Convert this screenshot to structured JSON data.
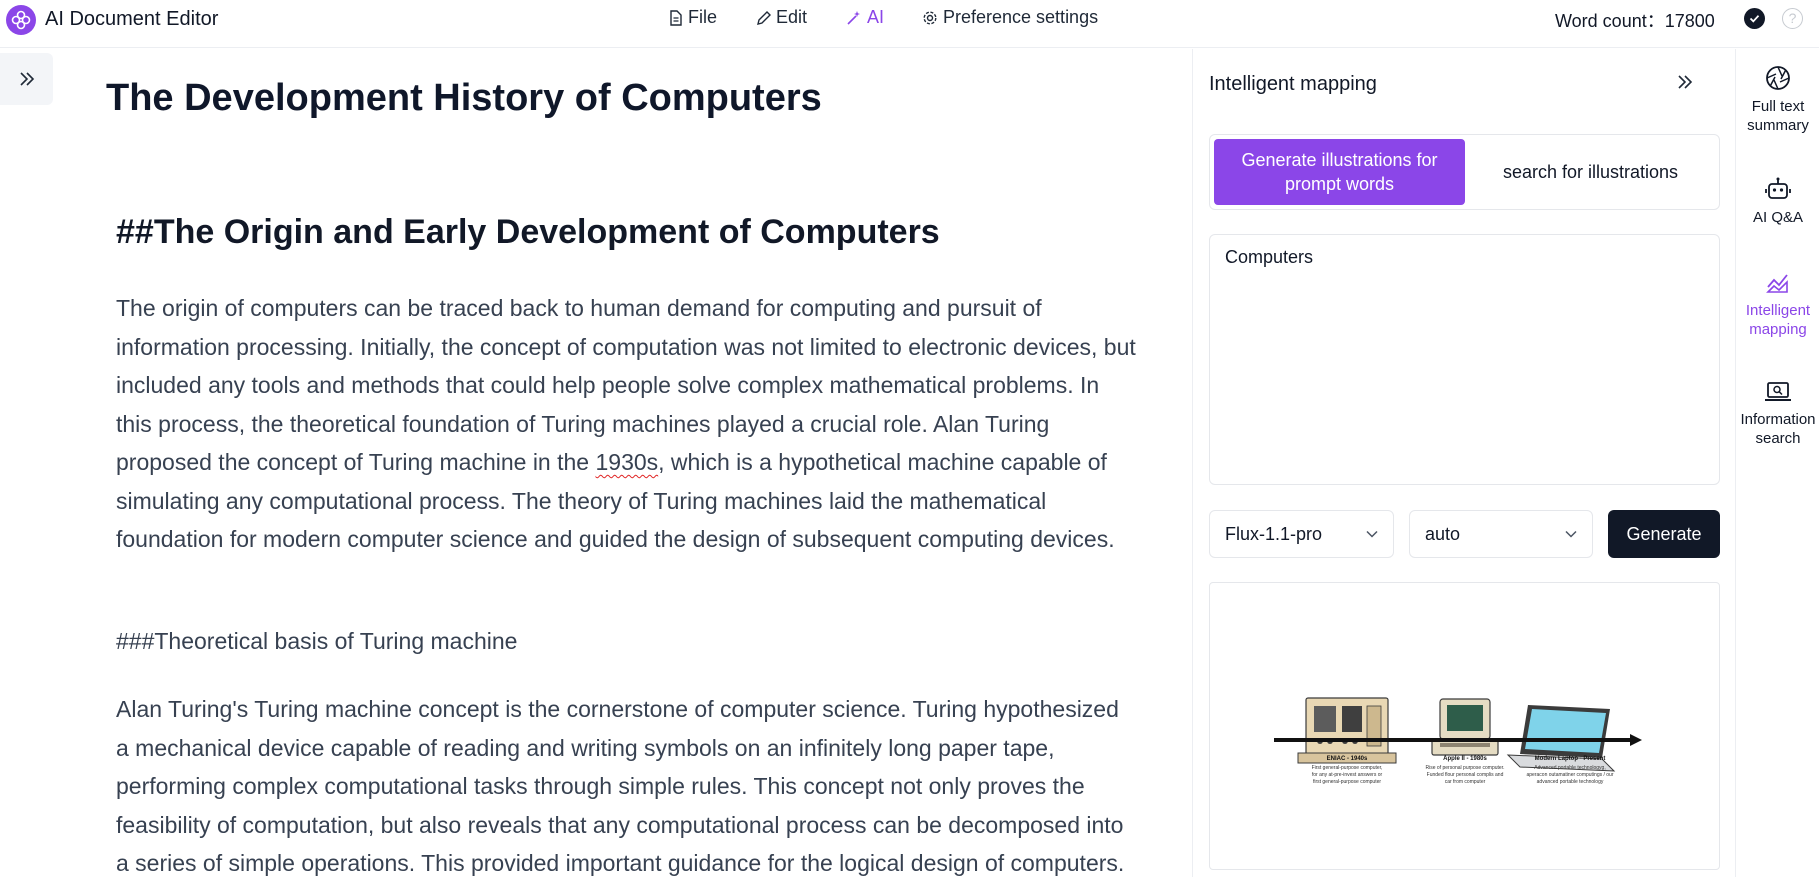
{
  "app": {
    "title": "AI Document Editor"
  },
  "menu": {
    "file": "File",
    "edit": "Edit",
    "ai": "AI",
    "preferences": "Preference settings"
  },
  "status": {
    "word_count": "Word count：17800",
    "help": "?"
  },
  "document": {
    "title": "The Development History of Computers",
    "h2": "##The Origin and Early Development of Computers",
    "p1_a": "The origin of computers can be traced back to human demand for computing and pursuit of information processing. Initially, the concept of computation was not limited to electronic devices, but included any tools and methods that could help people solve complex mathematical problems. In this process, the theoretical foundation of Turing machines played a crucial role. Alan Turing proposed the concept of Turing machine in the ",
    "p1_b": "1930s",
    "p1_c": ", which is a hypothetical machine capable of simulating any computational process. The theory of Turing machines laid the mathematical foundation for modern computer science and guided the design of subsequent computing devices.",
    "h3": "###Theoretical basis of Turing machine",
    "p2": "Alan Turing's Turing machine concept is the cornerstone of computer science. Turing hypothesized a mechanical device capable of reading and writing symbols on an infinitely long paper tape, performing complex computational tasks through simple rules. This concept not only proves the feasibility of computation, but also reveals that any computational process can be decomposed into a series of simple operations. This provided important guidance for the logical design of computers."
  },
  "panel": {
    "title": "Intelligent mapping",
    "tabs": [
      "Generate illustrations for prompt words",
      "search for illustrations"
    ],
    "prompt_value": "Computers",
    "model": "Flux-1.1-pro",
    "size": "auto",
    "generate": "Generate",
    "image": {
      "labels": [
        "ENIAC - 1940s",
        "Apple II - 1980s",
        "Modern Laptop - Present"
      ],
      "captions": [
        [
          "First general-purpose computer,",
          "for any at-pre-invest answers or",
          "first general-purpose computer"
        ],
        [
          "Rise of personal purpose computer.",
          "Funded flour personal complis and",
          "car from computer"
        ],
        [
          "Advanced portable technologyg,",
          "aperacon outamatiner computings / our",
          "advanced portable technology"
        ]
      ]
    }
  },
  "rail": {
    "items": [
      {
        "label": "Full text summary",
        "icon": "aperture-icon"
      },
      {
        "label": "AI Q&A",
        "icon": "robot-icon"
      },
      {
        "label": "Intelligent mapping",
        "icon": "chart-icon"
      },
      {
        "label": "Information search",
        "icon": "laptop-search-icon"
      }
    ]
  },
  "colors": {
    "accent": "#8b46e8",
    "dark": "#111827",
    "text": "#374151"
  }
}
